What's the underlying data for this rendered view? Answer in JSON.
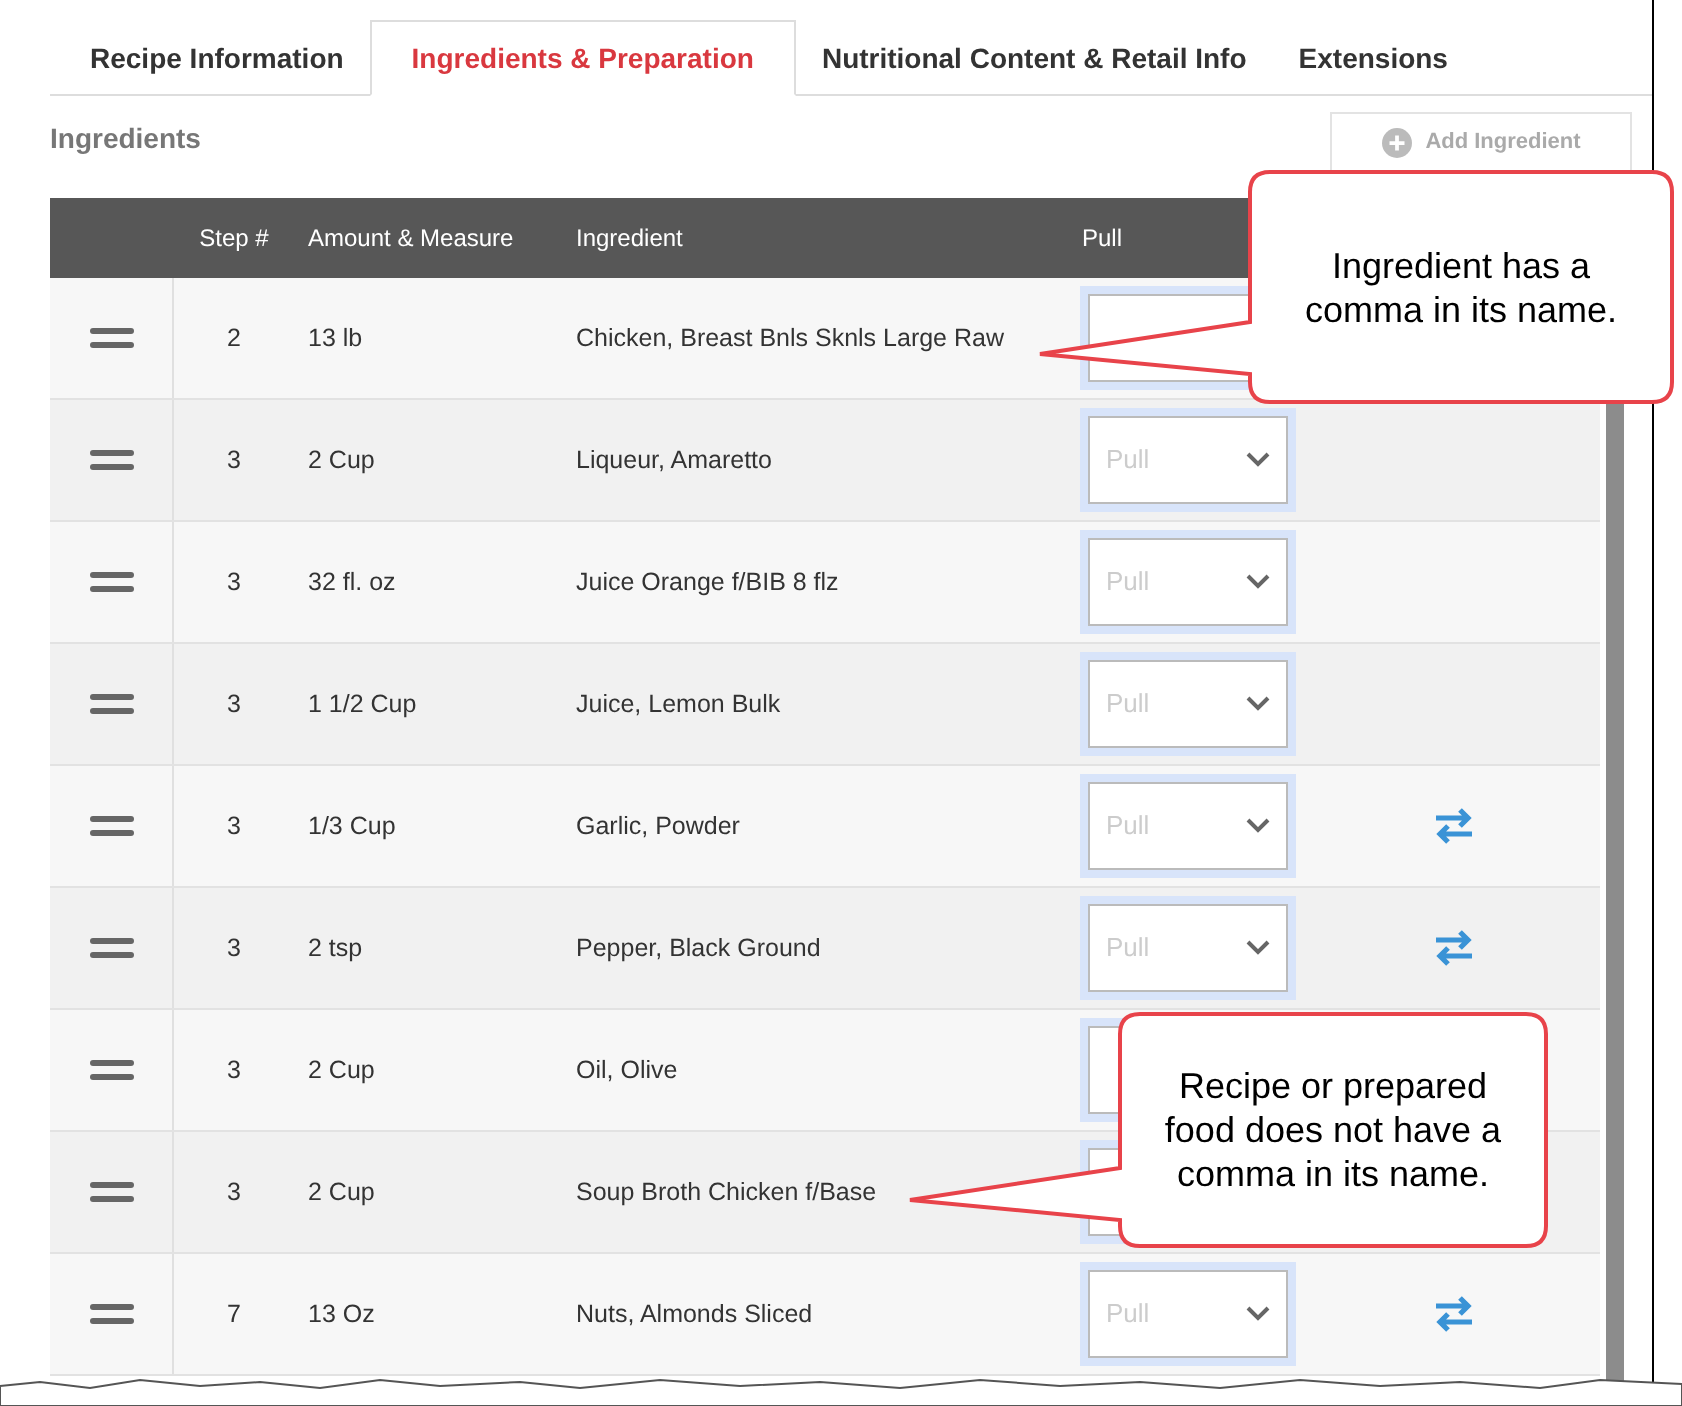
{
  "tabs": [
    {
      "label": "Recipe Information",
      "selected": false
    },
    {
      "label": "Ingredients & Preparation",
      "selected": true
    },
    {
      "label": "Nutritional Content & Retail Info",
      "selected": false
    },
    {
      "label": "Extensions",
      "selected": false
    }
  ],
  "section": {
    "title": "Ingredients",
    "add_button": "Add Ingredient"
  },
  "table": {
    "columns": [
      "Step #",
      "Amount & Measure",
      "Ingredient",
      "Pull"
    ],
    "rows": [
      {
        "step": "2",
        "amount": "13 lb",
        "ingredient": "Chicken, Breast Bnls Sknls Large Raw",
        "swap": false
      },
      {
        "step": "3",
        "amount": "2 Cup",
        "ingredient": "Liqueur, Amaretto",
        "pull_placeholder": "Pull",
        "swap": false
      },
      {
        "step": "3",
        "amount": "32 fl. oz",
        "ingredient": "Juice Orange f/BIB 8 flz",
        "pull_placeholder": "Pull",
        "swap": false
      },
      {
        "step": "3",
        "amount": "1 1/2 Cup",
        "ingredient": "Juice, Lemon Bulk",
        "pull_placeholder": "Pull",
        "swap": false
      },
      {
        "step": "3",
        "amount": "1/3 Cup",
        "ingredient": "Garlic, Powder",
        "pull_placeholder": "Pull",
        "swap": true
      },
      {
        "step": "3",
        "amount": "2 tsp",
        "ingredient": "Pepper, Black Ground",
        "pull_placeholder": "Pull",
        "swap": true
      },
      {
        "step": "3",
        "amount": "2 Cup",
        "ingredient": "Oil, Olive",
        "swap": false
      },
      {
        "step": "3",
        "amount": "2 Cup",
        "ingredient": "Soup Broth Chicken f/Base",
        "swap": false
      },
      {
        "step": "7",
        "amount": "13 Oz",
        "ingredient": "Nuts, Almonds Sliced",
        "pull_placeholder": "Pull",
        "swap": true
      }
    ]
  },
  "callouts": [
    {
      "text": "Ingredient has a comma in its name."
    },
    {
      "text": "Recipe or prepared food does not have a comma in its name."
    }
  ]
}
